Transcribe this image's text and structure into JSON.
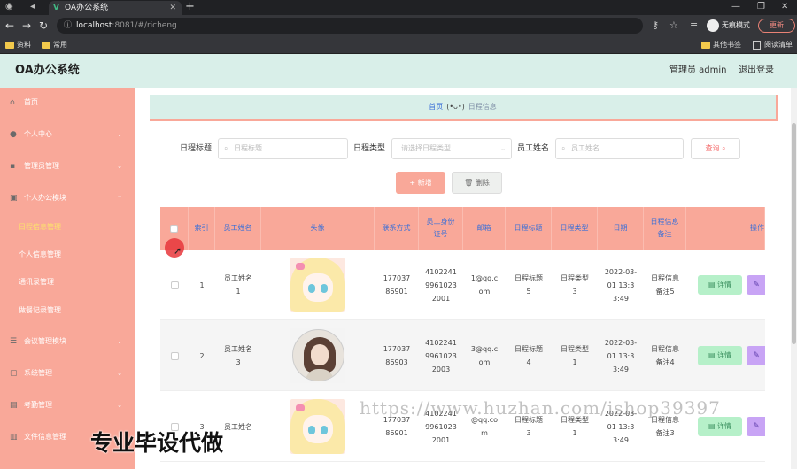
{
  "browser": {
    "tab_title": "OA办公系统",
    "url_host": "localhost",
    "url_port": ":8081",
    "url_path": "/#/richeng",
    "incognito": "无痕模式",
    "update": "更新",
    "bookmarks": [
      "资料",
      "常用"
    ],
    "bookmarks_right": [
      "其他书签",
      "阅读清单"
    ]
  },
  "header": {
    "brand": "OA办公系统",
    "admin": "管理员 admin",
    "logout": "退出登录"
  },
  "sidebar": {
    "menus": [
      {
        "label": "首页",
        "icon": "home-icon",
        "expandable": false
      },
      {
        "label": "个人中心",
        "icon": "user-icon",
        "expandable": true
      },
      {
        "label": "管理员管理",
        "icon": "admin-icon",
        "expandable": true
      },
      {
        "label": "个人办公模块",
        "icon": "briefcase-icon",
        "expandable": true,
        "expanded": true
      },
      {
        "label": "会议管理模块",
        "icon": "list-icon",
        "expandable": true
      },
      {
        "label": "系统管理",
        "icon": "system-icon",
        "expandable": true
      },
      {
        "label": "考勤管理",
        "icon": "attendance-icon",
        "expandable": true
      },
      {
        "label": "文件信息管理",
        "icon": "file-icon",
        "expandable": true
      }
    ],
    "submenus": [
      "日程信息管理",
      "个人信息管理",
      "通讯录管理",
      "做餐记录管理"
    ],
    "active_sub": "日程信息管理"
  },
  "breadcrumb": {
    "home": "首页",
    "sep": "(•ᴗ•)",
    "current": "日程信息"
  },
  "filters": {
    "title_label": "日程标题",
    "title_placeholder": "日程标题",
    "type_label": "日程类型",
    "type_placeholder": "请选择日程类型",
    "name_label": "员工姓名",
    "name_placeholder": "员工姓名",
    "query": "查询"
  },
  "actions": {
    "add": "+ 新增",
    "delete": "删除"
  },
  "table": {
    "columns": [
      "索引",
      "员工姓名",
      "头像",
      "联系方式",
      "员工身份证号",
      "邮箱",
      "日程标题",
      "日程类型",
      "日期",
      "日程信息备注",
      "操作"
    ],
    "rows": [
      {
        "index": "1",
        "name": "员工姓名1",
        "avatar": "anime",
        "phone": "17703786901",
        "idcard": "410224199610232001",
        "email": "1@qq.com",
        "title": "日程标题5",
        "type": "日程类型3",
        "date": "2022-03-01 13:33:49",
        "note": "日程信息备注5"
      },
      {
        "index": "2",
        "name": "员工姓名3",
        "avatar": "photo",
        "phone": "17703786903",
        "idcard": "410224199610232003",
        "email": "3@qq.com",
        "title": "日程标题4",
        "type": "日程类型1",
        "date": "2022-03-01 13:33:49",
        "note": "日程信息备注4"
      },
      {
        "index": "3",
        "name": "员工姓名",
        "avatar": "anime",
        "phone": "17703786901",
        "idcard": "410224199610232001",
        "email": "@qq.com",
        "title": "日程标题3",
        "type": "日程类型1",
        "date": "2022-03-01 13:33:49",
        "note": "日程信息备注3"
      }
    ],
    "detail": "详情",
    "edit_icon": "edit-icon"
  },
  "watermark": {
    "url": "https://www.huzhan.com/ishop39397",
    "text": "专业毕设代做"
  }
}
